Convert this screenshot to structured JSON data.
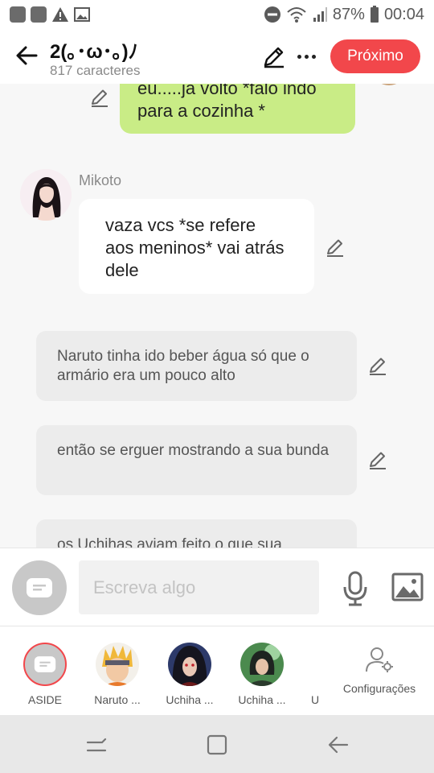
{
  "status": {
    "battery": "87%",
    "time": "00:04"
  },
  "header": {
    "title": "2(｡･ω･｡)ﾉ",
    "subtitle": "817 caracteres",
    "next_label": "Próximo"
  },
  "messages": {
    "green": "eu.....ja volto *falo indo para a cozinha *",
    "mikoto_name": "Mikoto",
    "mikoto": "vaza vcs *se refere aos meninos* vai atrás dele",
    "gray1": "Naruto tinha ido beber água só que o armário era um pouco alto",
    "gray2": "então se erguer mostrando a sua bunda",
    "gray3": "os Uchihas aviam feito o que sua"
  },
  "input": {
    "placeholder": "Escreva algo"
  },
  "characters": [
    {
      "label": "ASIDE"
    },
    {
      "label": "Naruto ..."
    },
    {
      "label": "Uchiha ..."
    },
    {
      "label": "Uchiha ..."
    },
    {
      "label": "U"
    }
  ],
  "config_label": "Configurações",
  "colors": {
    "accent": "#f2474b",
    "green_bubble": "#c9ec86",
    "gray_bubble": "#ececec"
  }
}
